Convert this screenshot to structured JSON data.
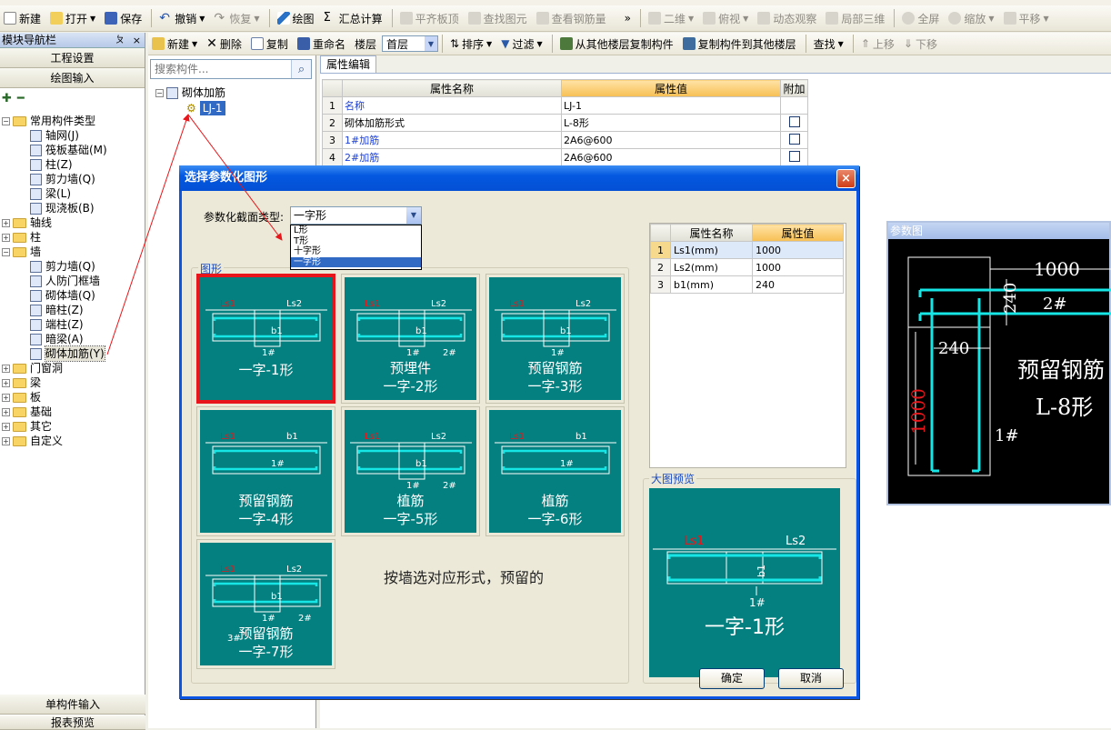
{
  "toolbar1": {
    "new": "新建",
    "open": "打开",
    "save": "保存",
    "undo": "撤销",
    "redo": "恢复",
    "draw": "绘图",
    "summary": "汇总计算",
    "align_top": "平齐板顶",
    "find_elem": "查找图元",
    "view_rebar": "查看钢筋量",
    "more": "»",
    "view2d": "二维",
    "top_view": "俯视",
    "dyn_view": "动态观察",
    "local3d": "局部三维",
    "fullscreen": "全屏",
    "zoom": "缩放",
    "pan": "平移"
  },
  "nav": {
    "title": "模块导航栏",
    "pin": "ㄆ",
    "close": "×",
    "project_settings": "工程设置",
    "drawing_input": "绘图输入",
    "tree": [
      {
        "label": "常用构件类型",
        "kind": "folder",
        "expanded": true,
        "level": 0
      },
      {
        "label": "轴网(J)",
        "kind": "comp",
        "level": 1
      },
      {
        "label": "筏板基础(M)",
        "kind": "comp",
        "level": 1
      },
      {
        "label": "柱(Z)",
        "kind": "comp",
        "level": 1
      },
      {
        "label": "剪力墙(Q)",
        "kind": "comp",
        "level": 1
      },
      {
        "label": "梁(L)",
        "kind": "comp",
        "level": 1
      },
      {
        "label": "现浇板(B)",
        "kind": "comp",
        "level": 1
      },
      {
        "label": "轴线",
        "kind": "folder",
        "expanded": false,
        "level": 0
      },
      {
        "label": "柱",
        "kind": "folder",
        "expanded": false,
        "level": 0
      },
      {
        "label": "墙",
        "kind": "folder",
        "expanded": true,
        "level": 0
      },
      {
        "label": "剪力墙(Q)",
        "kind": "comp",
        "level": 1
      },
      {
        "label": "人防门框墙",
        "kind": "comp",
        "level": 1
      },
      {
        "label": "砌体墙(Q)",
        "kind": "comp",
        "level": 1
      },
      {
        "label": "暗柱(Z)",
        "kind": "comp",
        "level": 1
      },
      {
        "label": "端柱(Z)",
        "kind": "comp",
        "level": 1
      },
      {
        "label": "暗梁(A)",
        "kind": "comp",
        "level": 1
      },
      {
        "label": "砌体加筋(Y)",
        "kind": "comp",
        "level": 1,
        "selected": true
      },
      {
        "label": "门窗洞",
        "kind": "folder",
        "expanded": false,
        "level": 0
      },
      {
        "label": "梁",
        "kind": "folder",
        "expanded": false,
        "level": 0
      },
      {
        "label": "板",
        "kind": "folder",
        "expanded": false,
        "level": 0
      },
      {
        "label": "基础",
        "kind": "folder",
        "expanded": false,
        "level": 0
      },
      {
        "label": "其它",
        "kind": "folder",
        "expanded": false,
        "level": 0
      },
      {
        "label": "自定义",
        "kind": "folder",
        "expanded": false,
        "level": 0
      }
    ],
    "single_input": "单构件输入",
    "report_preview": "报表预览"
  },
  "toolbar2": {
    "new": "新建",
    "delete": "删除",
    "copy": "复制",
    "rename": "重命名",
    "floor_label": "楼层",
    "floor_value": "首层",
    "sort": "排序",
    "filter": "过滤",
    "copy_from_other": "从其他楼层复制构件",
    "copy_to_other": "复制构件到其他楼层",
    "find": "查找",
    "move_up": "上移",
    "move_down": "下移"
  },
  "comp_tree": {
    "search_placeholder": "搜索构件...",
    "root": "砌体加筋",
    "item": "LJ-1"
  },
  "prop": {
    "tab": "属性编辑",
    "headers": [
      "属性名称",
      "属性值",
      "附加"
    ],
    "rows": [
      {
        "no": "1",
        "name": "名称",
        "value": "LJ-1",
        "blue": true,
        "check": false
      },
      {
        "no": "2",
        "name": "砌体加筋形式",
        "value": "L-8形",
        "blue": false,
        "check": true
      },
      {
        "no": "3",
        "name": "1#加筋",
        "value": "2A6@600",
        "blue": true,
        "check": true
      },
      {
        "no": "4",
        "name": "2#加筋",
        "value": "2A6@600",
        "blue": true,
        "check": true
      }
    ]
  },
  "dialog": {
    "title": "选择参数化图形",
    "close": "×",
    "type_label": "参数化截面类型:",
    "type_value": "一字形",
    "type_options": [
      "L形",
      "T形",
      "十字形",
      "一字形"
    ],
    "shapes_legend": "图形",
    "shapes": [
      {
        "line1": "一字-1形",
        "line2": "",
        "labels": [
          "Ls1",
          "Ls2",
          "b1",
          "1#"
        ]
      },
      {
        "line1": "预埋件",
        "line2": "一字-2形",
        "labels": [
          "Ls1",
          "Ls2",
          "b1",
          "1#",
          "2#"
        ]
      },
      {
        "line1": "预留钢筋",
        "line2": "一字-3形",
        "labels": [
          "Ls1",
          "Ls2",
          "b1",
          "1#"
        ]
      },
      {
        "line1": "预留钢筋",
        "line2": "一字-4形",
        "labels": [
          "Ls1",
          "b1",
          "1#"
        ]
      },
      {
        "line1": "植筋",
        "line2": "一字-5形",
        "labels": [
          "Ls1",
          "Ls2",
          "b1",
          "1#",
          "2#"
        ]
      },
      {
        "line1": "植筋",
        "line2": "一字-6形",
        "labels": [
          "Ls1",
          "b1",
          "1#"
        ]
      },
      {
        "line1": "预留钢筋",
        "line2": "一字-7形",
        "labels": [
          "Ls1",
          "Ls2",
          "b1",
          "1#",
          "2#",
          "3#"
        ]
      }
    ],
    "hint": "按墙选对应形式，预留的",
    "param_headers": [
      "属性名称",
      "属性值"
    ],
    "params": [
      {
        "no": "1",
        "name": "Ls1(mm)",
        "value": "1000"
      },
      {
        "no": "2",
        "name": "Ls2(mm)",
        "value": "1000"
      },
      {
        "no": "3",
        "name": "b1(mm)",
        "value": "240"
      }
    ],
    "preview_legend": "大图预览",
    "preview": {
      "caption": "一字-1形",
      "labels": [
        "Ls1",
        "Ls2",
        "b1",
        "1#"
      ]
    },
    "ok": "确定",
    "cancel": "取消"
  },
  "param_figure": {
    "title": "参数图",
    "dims": [
      "1000",
      "240",
      "240",
      "1000"
    ],
    "bars": [
      "2#",
      "1#"
    ],
    "text1": "预留钢筋",
    "text2": "L-8形"
  },
  "colors": {
    "teal": "#058080",
    "cyan": "#16e6e6",
    "red_label": "#e8161a",
    "selection_blue": "#316ac5",
    "title_blue": "#0458e0"
  }
}
